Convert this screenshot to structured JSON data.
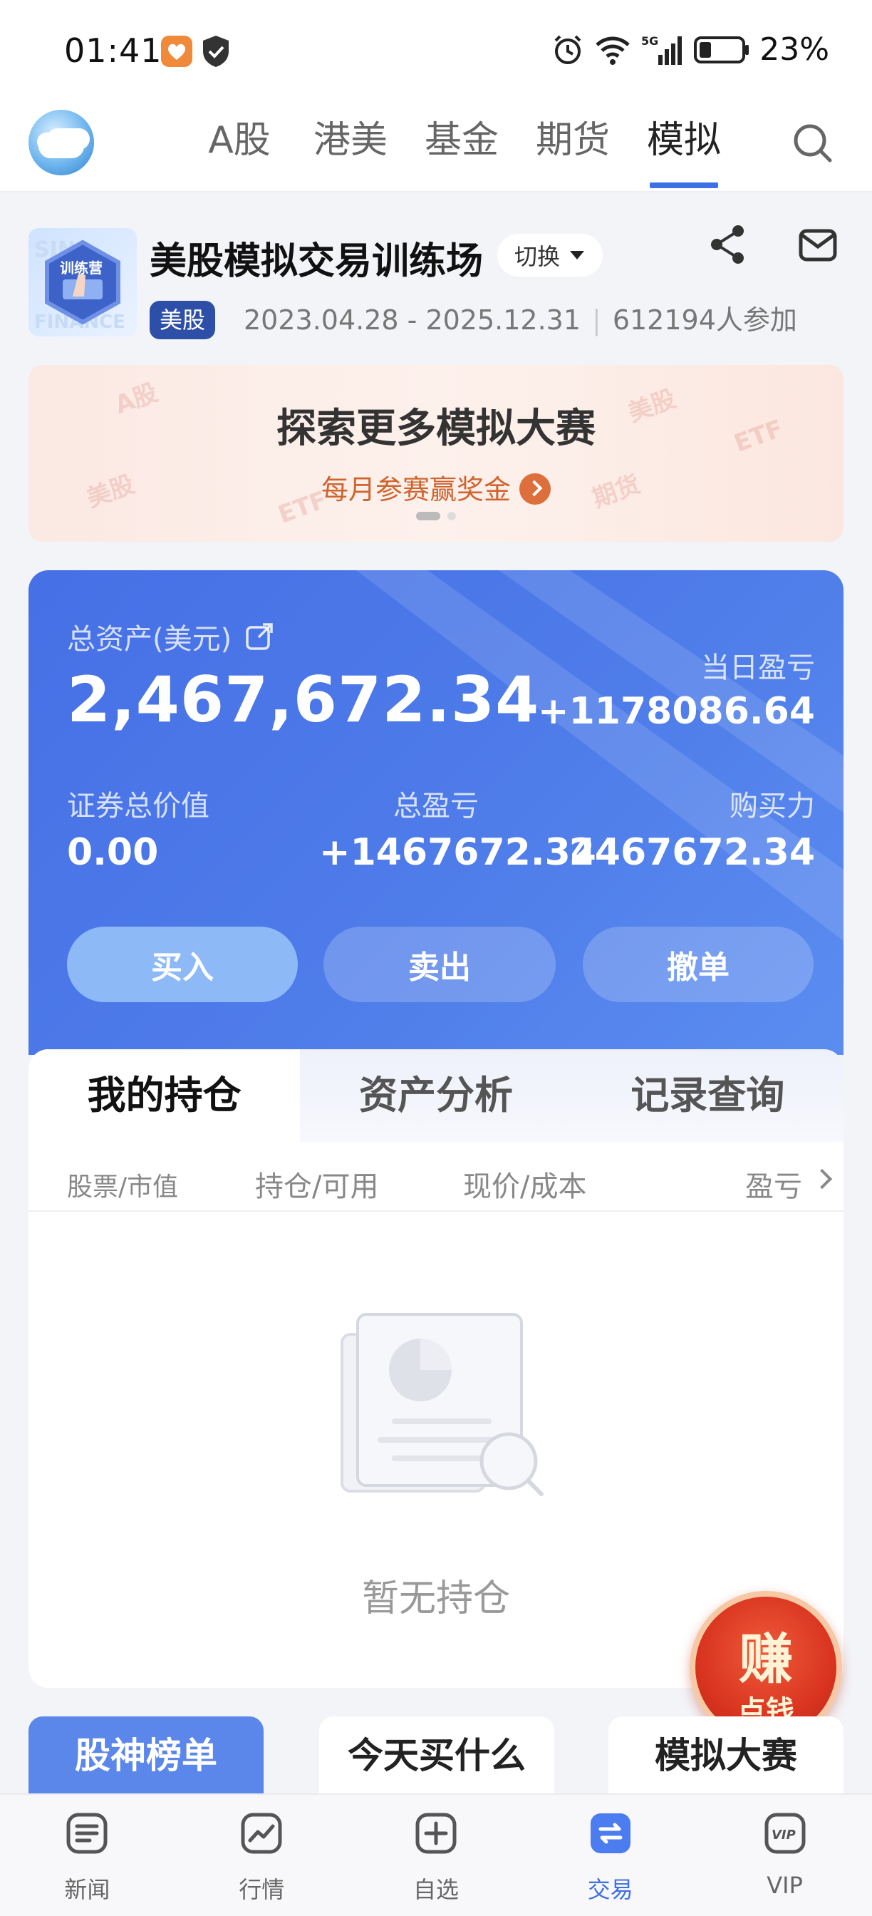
{
  "status_bar": {
    "time": "01:41",
    "battery": "23%",
    "network": "5G"
  },
  "top_nav": {
    "tabs": [
      {
        "label": "A股"
      },
      {
        "label": "港美"
      },
      {
        "label": "基金"
      },
      {
        "label": "期货"
      },
      {
        "label": "模拟"
      }
    ],
    "active_tab": "模拟"
  },
  "contest": {
    "thumb_text": "训练营",
    "title": "美股模拟交易训练场",
    "switch_label": "切换",
    "badge": "美股",
    "date_range": "2023.04.28 - 2025.12.31",
    "participants": "612194人参加"
  },
  "banner": {
    "title": "探索更多模拟大赛",
    "subtitle": "每月参赛赢奖金",
    "watermarks": [
      "A股",
      "美股",
      "ETF",
      "美股",
      "ETF",
      "期货"
    ]
  },
  "assets": {
    "total_label": "总资产(美元)",
    "total_value": "2,467,672.34",
    "daily_pl_label": "当日盈亏",
    "daily_pl_value": "+1178086.64",
    "securities_label": "证券总价值",
    "securities_value": "0.00",
    "total_pl_label": "总盈亏",
    "total_pl_value": "+1467672.34",
    "buying_power_label": "购买力",
    "buying_power_value": "2467672.34",
    "buttons": {
      "buy": "买入",
      "sell": "卖出",
      "cancel": "撤单"
    }
  },
  "holdings": {
    "tabs": [
      "我的持仓",
      "资产分析",
      "记录查询"
    ],
    "columns": [
      "股票/市值",
      "持仓/可用",
      "现价/成本",
      "盈亏"
    ],
    "empty_text": "暂无持仓"
  },
  "earn_float": {
    "big": "赚",
    "small": "点钱"
  },
  "quick_tabs": [
    "股神榜单",
    "今天买什么",
    "模拟大赛"
  ],
  "bottom_nav": [
    {
      "label": "新闻",
      "icon": "news-icon"
    },
    {
      "label": "行情",
      "icon": "chart-icon"
    },
    {
      "label": "自选",
      "icon": "add-icon"
    },
    {
      "label": "交易",
      "icon": "trade-icon"
    },
    {
      "label": "VIP",
      "icon": "vip-icon"
    }
  ],
  "colors": {
    "accent": "#3d6fe5",
    "card": "#4a74e7",
    "orange": "#d0642f",
    "earn": "#d9341f"
  }
}
